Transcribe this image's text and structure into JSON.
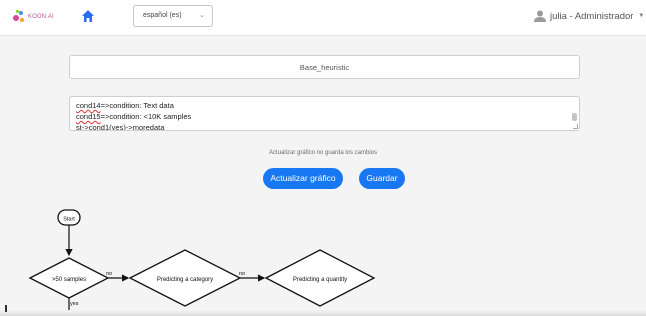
{
  "header": {
    "logo_text": "KOON.AI",
    "home_icon": "home-icon",
    "language": "español (es)",
    "user_label": "julia - Administrador",
    "user_icon": "user-icon"
  },
  "editor": {
    "title_value": "Base_heuristic",
    "code_lines": [
      [
        "cond14",
        "=>condition: Text data"
      ],
      [
        "cond15",
        "=>condition: <10K samples"
      ],
      [
        "st->cond1(yes)->",
        "moredata"
      ]
    ]
  },
  "note": "Actualizar gráfico no guarda los cambios",
  "buttons": {
    "update": "Actualizar gráfico",
    "save": "Guardar"
  },
  "flowchart": {
    "start": "Start",
    "decisions": [
      ">50 samples",
      "Predicting a category",
      "Predicting a quantity"
    ],
    "edges": [
      "no",
      "no",
      "yes"
    ]
  },
  "colors": {
    "primary": "#1877f2",
    "logo": "#b9579b",
    "home": "#2a6ef0"
  }
}
